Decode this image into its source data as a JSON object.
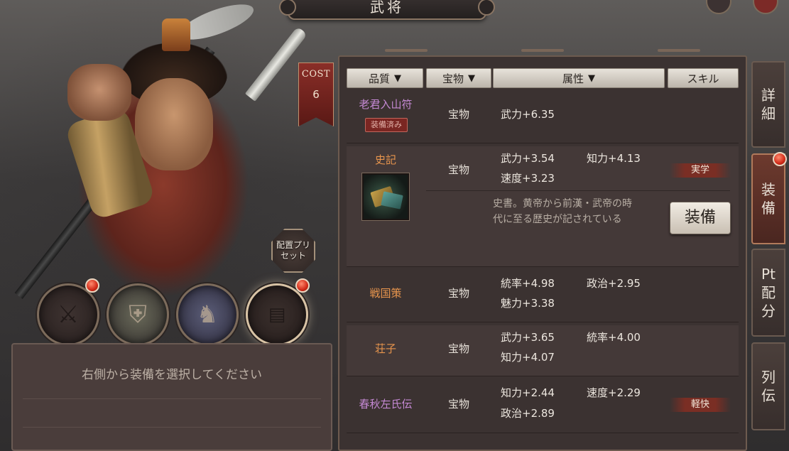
{
  "header": {
    "title": "武将"
  },
  "hero": {
    "cost_label": "COST",
    "cost_value": "6",
    "preset_label_1": "配置プリ",
    "preset_label_2": "セット"
  },
  "slots": [
    {
      "name": "weapon",
      "icon": "crossed-swords-icon",
      "has_notice": true
    },
    {
      "name": "armor",
      "icon": "armor-icon",
      "has_notice": false
    },
    {
      "name": "mount",
      "icon": "horse-icon",
      "has_notice": false
    },
    {
      "name": "treasure",
      "icon": "treasure-book-icon",
      "has_notice": true,
      "selected": true
    }
  ],
  "message": {
    "text": "右側から装備を選択してください"
  },
  "table": {
    "headers": {
      "quality": "品質",
      "treasure": "宝物",
      "attribute": "属性",
      "skill": "スキル"
    },
    "rows": [
      {
        "name": "老君入山符",
        "name_color": "purple",
        "type": "宝物",
        "stats": [
          "武力+6.35"
        ],
        "badge": "装備済み",
        "skill": ""
      },
      {
        "name": "史記",
        "name_color": "orange",
        "type": "宝物",
        "stats": [
          "武力+3.54",
          "知力+4.13",
          "速度+3.23"
        ],
        "skill": "実学",
        "description_1": "史書。黄帝から前漢・武帝の時",
        "description_2": "代に至る歴史が記されている",
        "action": "装備",
        "icon": "book-scroll-icon"
      },
      {
        "name": "戦国策",
        "name_color": "orange",
        "type": "宝物",
        "stats": [
          "統率+4.98",
          "政治+2.95",
          "魅力+3.38"
        ],
        "skill": ""
      },
      {
        "name": "荘子",
        "name_color": "orange",
        "type": "宝物",
        "stats": [
          "武力+3.65",
          "統率+4.00",
          "知力+4.07"
        ],
        "skill": ""
      },
      {
        "name": "春秋左氏伝",
        "name_color": "purple",
        "type": "宝物",
        "stats": [
          "知力+2.44",
          "速度+2.29",
          "政治+2.89"
        ],
        "skill": "軽快"
      }
    ]
  },
  "side_tabs": [
    {
      "label_1": "詳",
      "label_2": "細",
      "active": false
    },
    {
      "label_1": "装",
      "label_2": "備",
      "active": true,
      "has_notice": true
    },
    {
      "label_1": "Pt",
      "label_2": "配",
      "label_3": "分",
      "active": false
    },
    {
      "label_1": "列",
      "label_2": "伝",
      "active": false
    }
  ],
  "colors": {
    "purple_quality": "#c589d4",
    "orange_quality": "#e8954d",
    "skill_tag": "#7a2e24",
    "notice_dot": "#d12a18"
  }
}
